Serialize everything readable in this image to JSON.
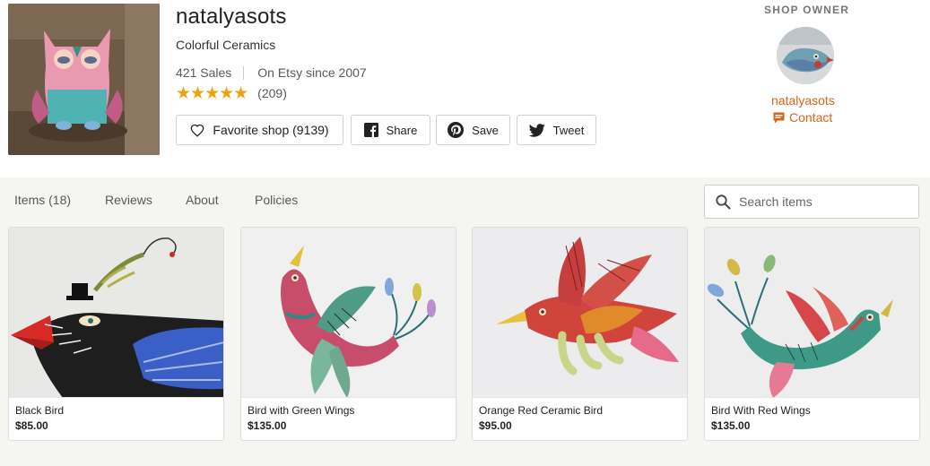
{
  "shop": {
    "name": "natalyasots",
    "tagline": "Colorful Ceramics",
    "sales": "421 Sales",
    "since": "On Etsy since 2007",
    "stars": "★★★★★",
    "rating_value": 5,
    "review_count": "(209)"
  },
  "actions": {
    "favorite_label": "Favorite shop (9139)",
    "share_label": "Share",
    "save_label": "Save",
    "tweet_label": "Tweet"
  },
  "owner": {
    "heading": "SHOP OWNER",
    "name": "natalyasots",
    "contact_label": "Contact"
  },
  "nav": {
    "tabs": [
      {
        "label": "Items (18)"
      },
      {
        "label": "Reviews"
      },
      {
        "label": "About"
      },
      {
        "label": "Policies"
      }
    ],
    "search_placeholder": "Search items"
  },
  "listings": [
    {
      "title": "Black Bird",
      "price": "$85.00"
    },
    {
      "title": "Bird with Green Wings",
      "price": "$135.00"
    },
    {
      "title": "Orange Red Ceramic Bird",
      "price": "$95.00"
    },
    {
      "title": "Bird With Red Wings",
      "price": "$135.00"
    }
  ],
  "colors": {
    "accent_orange": "#d5641c",
    "star_gold": "#f1a10f",
    "nav_background": "#f5f5f1"
  },
  "icons": {
    "favorite": "heart-icon",
    "share": "facebook-icon",
    "save": "pinterest-icon",
    "tweet": "twitter-icon",
    "contact": "message-icon",
    "search": "search-icon"
  }
}
